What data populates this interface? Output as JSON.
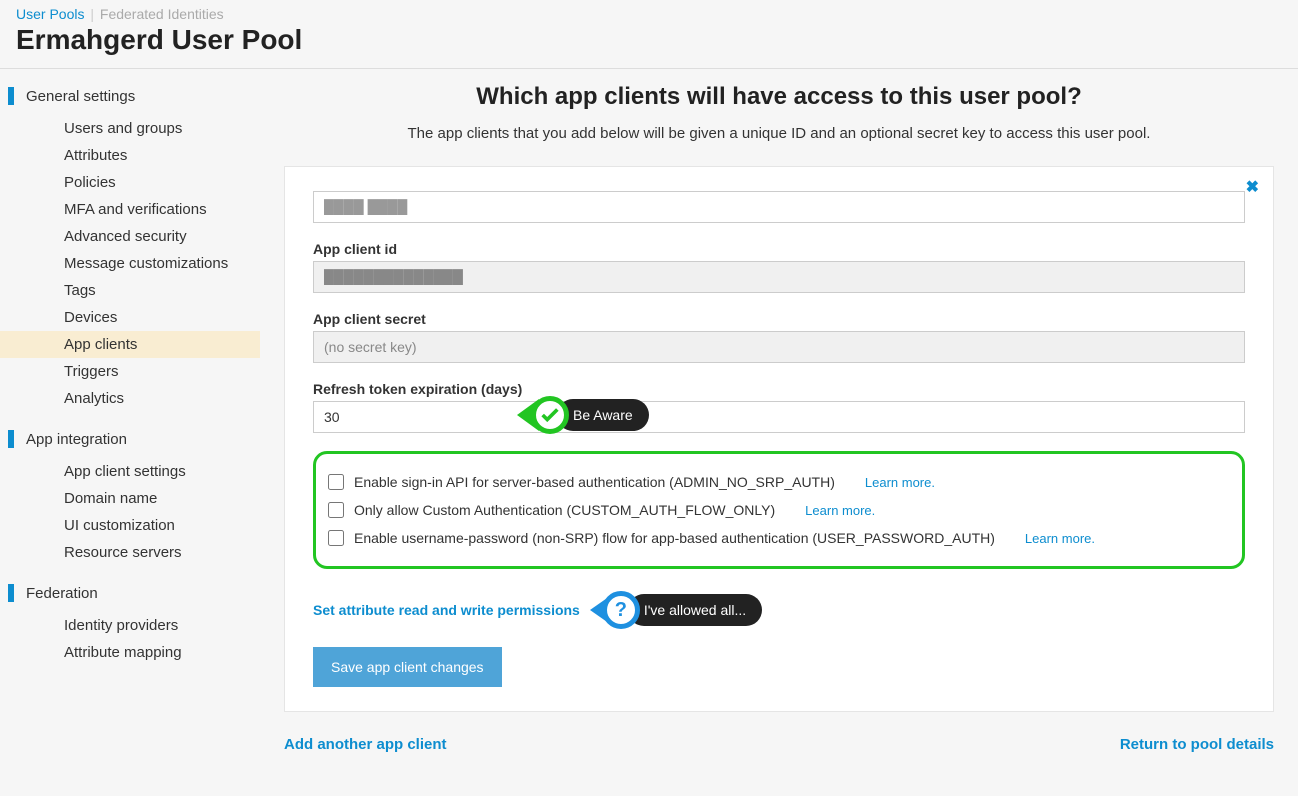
{
  "header": {
    "tab_active": "User Pools",
    "tab_inactive": "Federated Identities",
    "pool_title": "Ermahgerd User Pool"
  },
  "sidebar": {
    "sections": [
      {
        "label": "General settings",
        "items": [
          "Users and groups",
          "Attributes",
          "Policies",
          "MFA and verifications",
          "Advanced security",
          "Message customizations",
          "Tags",
          "Devices",
          "App clients",
          "Triggers",
          "Analytics"
        ],
        "selected": "App clients"
      },
      {
        "label": "App integration",
        "items": [
          "App client settings",
          "Domain name",
          "UI customization",
          "Resource servers"
        ]
      },
      {
        "label": "Federation",
        "items": [
          "Identity providers",
          "Attribute mapping"
        ]
      }
    ]
  },
  "main": {
    "title": "Which app clients will have access to this user pool?",
    "desc": "The app clients that you add below will be given a unique ID and an optional secret key to access this user pool.",
    "app_client_name": "████ ████",
    "app_client_id_label": "App client id",
    "app_client_id": "██████████████",
    "app_client_secret_label": "App client secret",
    "app_client_secret": "(no secret key)",
    "refresh_label": "Refresh token expiration (days)",
    "refresh_value": "30",
    "auth_options": [
      {
        "label": "Enable sign-in API for server-based authentication (ADMIN_NO_SRP_AUTH)",
        "learn": "Learn more."
      },
      {
        "label": "Only allow Custom Authentication (CUSTOM_AUTH_FLOW_ONLY)",
        "learn": "Learn more."
      },
      {
        "label": "Enable username-password (non-SRP) flow for app-based authentication (USER_PASSWORD_AUTH)",
        "learn": "Learn more."
      }
    ],
    "set_attr": "Set attribute read and write permissions",
    "save_btn": "Save app client changes",
    "add_another": "Add another app client",
    "return_link": "Return to pool details",
    "callout_beaware": "Be Aware",
    "callout_allowed": "I've allowed all..."
  }
}
